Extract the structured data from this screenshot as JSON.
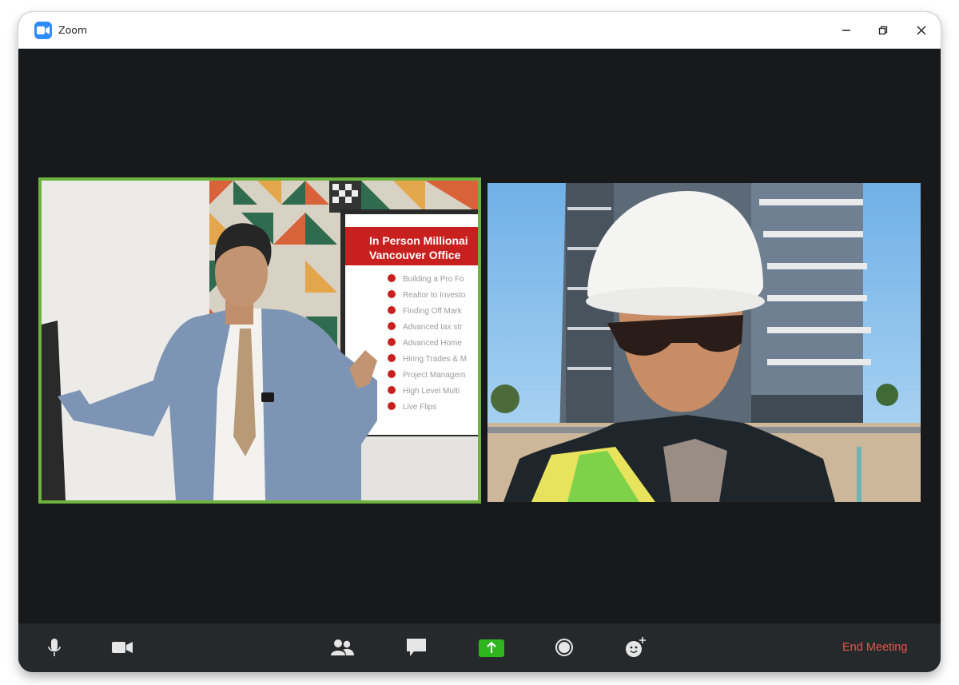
{
  "window": {
    "title": "Zoom"
  },
  "participants": [
    {
      "id": "presenter",
      "active_speaker": true
    },
    {
      "id": "site-worker",
      "active_speaker": false
    }
  ],
  "slide": {
    "heading_line1": "In Person Millionai",
    "heading_line2": "Vancouver Office",
    "items": [
      "Building a Pro Fo",
      "Realtor to Investo",
      "Finding Off Mark",
      "Advanced tax str",
      "Advanced Home",
      "Hiring Trades & M",
      "Project Managem",
      "High Level Multi",
      "Live Flips"
    ]
  },
  "toolbar": {
    "end_meeting_label": "End Meeting",
    "buttons": [
      "microphone-icon",
      "video-camera-icon",
      "participants-icon",
      "chat-icon",
      "share-screen-icon",
      "record-icon",
      "reactions-icon"
    ]
  },
  "colors": {
    "active_speaker_border": "#6cb33f",
    "share_button": "#2fb51e",
    "end_meeting": "#e2554a",
    "zoom_brand": "#2d8cff"
  }
}
